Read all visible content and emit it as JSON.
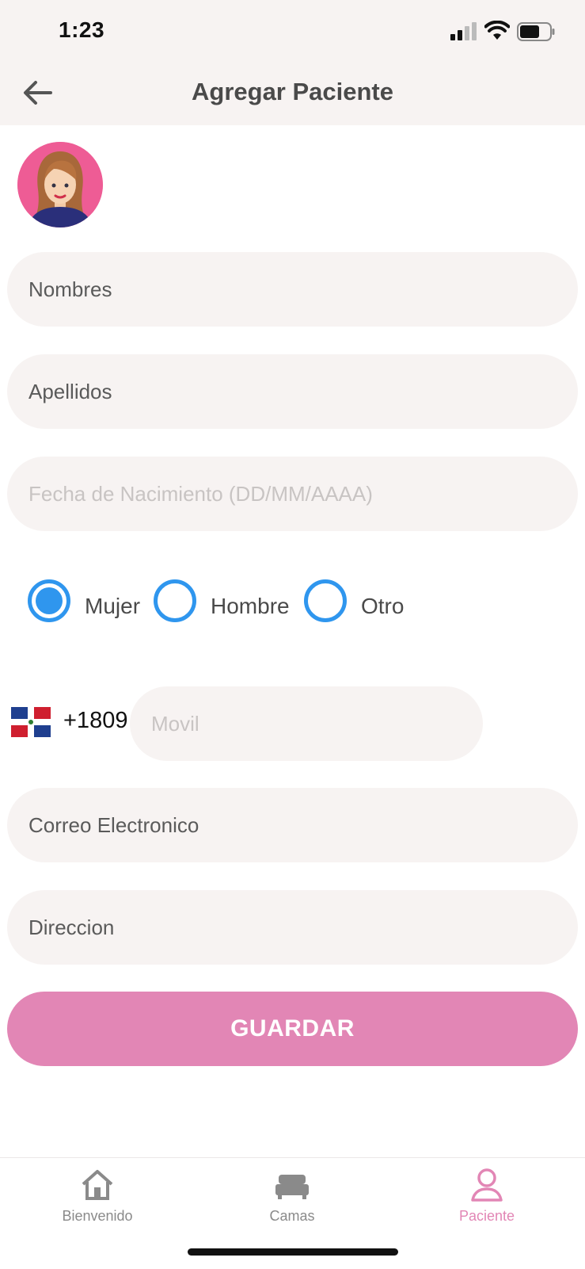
{
  "status_bar": {
    "time": "1:23"
  },
  "header": {
    "title": "Agregar Paciente"
  },
  "form": {
    "nombres_placeholder": "Nombres",
    "apellidos_placeholder": "Apellidos",
    "fecha_placeholder": "Fecha de Nacimiento (DD/MM/AAAA)",
    "gender": {
      "options": [
        "Mujer",
        "Hombre",
        "Otro"
      ],
      "selected": "Mujer"
    },
    "phone": {
      "country_code": "+1809",
      "placeholder": "Movil"
    },
    "correo_placeholder": "Correo Electronico",
    "direccion_placeholder": "Direccion",
    "save_label": "GUARDAR"
  },
  "tabs": [
    {
      "label": "Bienvenido",
      "icon": "home-icon"
    },
    {
      "label": "Camas",
      "icon": "bed-icon"
    },
    {
      "label": "Paciente",
      "icon": "person-icon",
      "active": true
    }
  ],
  "colors": {
    "accent_pink": "#e286b5",
    "radio_blue": "#2f96ee",
    "field_bg": "#f7f3f2",
    "avatar_bg": "#ee5c95"
  }
}
